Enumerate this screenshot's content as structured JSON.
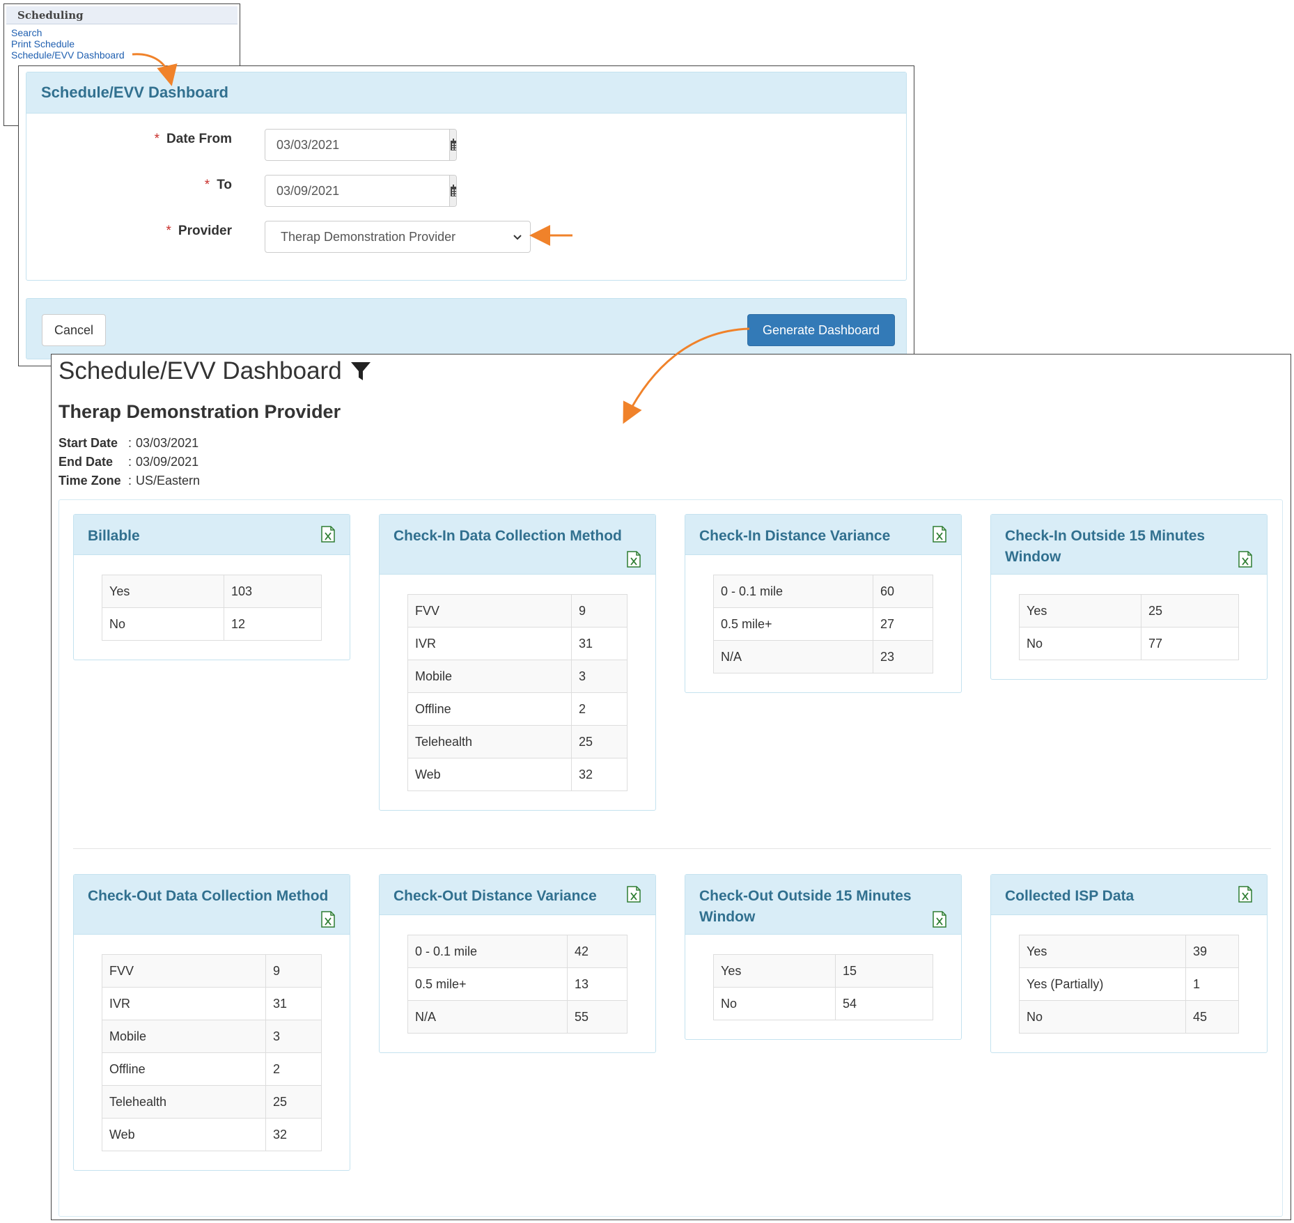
{
  "menu": {
    "title": "Scheduling",
    "items": [
      "Search",
      "Print Schedule",
      "Schedule/EVV Dashboard"
    ]
  },
  "filter_form": {
    "title": "Schedule/EVV Dashboard",
    "date_from_label": "Date From",
    "date_from_value": "03/03/2021",
    "to_label": "To",
    "to_value": "03/09/2021",
    "provider_label": "Provider",
    "provider_value": "Therap Demonstration Provider",
    "required_mark": "*",
    "cancel_label": "Cancel",
    "generate_label": "Generate Dashboard"
  },
  "dashboard": {
    "title": "Schedule/EVV Dashboard",
    "provider": "Therap Demonstration Provider",
    "meta": [
      {
        "label": "Start Date",
        "value": "03/03/2021"
      },
      {
        "label": "End Date",
        "value": "03/09/2021"
      },
      {
        "label": "Time Zone",
        "value": "US/Eastern"
      }
    ],
    "cards": [
      {
        "title": "Billable",
        "rows": [
          [
            "Yes",
            "103"
          ],
          [
            "No",
            "12"
          ]
        ]
      },
      {
        "title": "Check-In Data Collection Method",
        "rows": [
          [
            "FVV",
            "9"
          ],
          [
            "IVR",
            "31"
          ],
          [
            "Mobile",
            "3"
          ],
          [
            "Offline",
            "2"
          ],
          [
            "Telehealth",
            "25"
          ],
          [
            "Web",
            "32"
          ]
        ]
      },
      {
        "title": "Check-In Distance Variance",
        "rows": [
          [
            "0 - 0.1 mile",
            "60"
          ],
          [
            "0.5 mile+",
            "27"
          ],
          [
            "N/A",
            "23"
          ]
        ]
      },
      {
        "title": "Check-In Outside 15 Minutes Window",
        "rows": [
          [
            "Yes",
            "25"
          ],
          [
            "No",
            "77"
          ]
        ]
      },
      {
        "title": "Check-Out Data Collection Method",
        "rows": [
          [
            "FVV",
            "9"
          ],
          [
            "IVR",
            "31"
          ],
          [
            "Mobile",
            "3"
          ],
          [
            "Offline",
            "2"
          ],
          [
            "Telehealth",
            "25"
          ],
          [
            "Web",
            "32"
          ]
        ]
      },
      {
        "title": "Check-Out Distance Variance",
        "rows": [
          [
            "0 - 0.1 mile",
            "42"
          ],
          [
            "0.5 mile+",
            "13"
          ],
          [
            "N/A",
            "55"
          ]
        ]
      },
      {
        "title": "Check-Out Outside 15 Minutes Window",
        "rows": [
          [
            "Yes",
            "15"
          ],
          [
            "No",
            "54"
          ]
        ]
      },
      {
        "title": "Collected ISP Data",
        "rows": [
          [
            "Yes",
            "39"
          ],
          [
            "Yes (Partially)",
            "1"
          ],
          [
            "No",
            "45"
          ]
        ]
      }
    ]
  },
  "colors": {
    "panel_header_bg": "#d9edf7",
    "panel_header_text": "#31708f",
    "primary_button": "#337ab7",
    "annotation_arrow": "#f0822a",
    "excel_icon": "#2e7d32",
    "required": "#c9302c"
  },
  "icons": [
    "calendar-icon",
    "chevron-down-icon",
    "filter-icon",
    "excel-export-icon"
  ]
}
